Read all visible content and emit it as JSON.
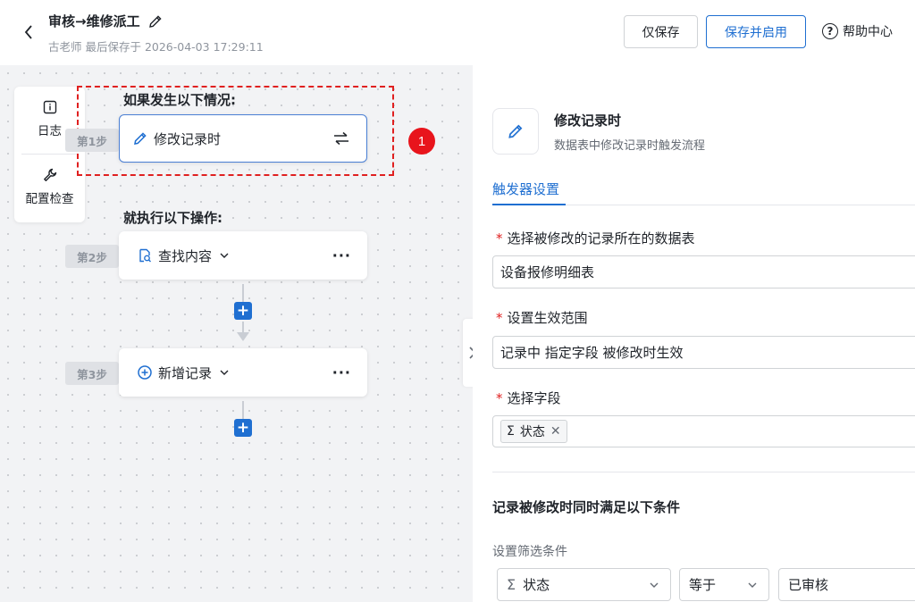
{
  "header": {
    "back_icon": "chevron-left-icon",
    "title": "审核→维修派工",
    "edit_icon": "pencil-icon",
    "subtitle": "古老师 最后保存于 2026-04-03 17:29:11",
    "save_only_label": "仅保存",
    "save_enable_label": "保存并启用",
    "help_label": "帮助中心",
    "accent_color": "#1f6fd1"
  },
  "side_tools": [
    {
      "icon": "info-icon",
      "label": "日志"
    },
    {
      "icon": "wrench-icon",
      "label": "配置检查"
    }
  ],
  "canvas": {
    "trigger_heading": "如果发生以下情况:",
    "action_heading": "就执行以下操作:",
    "steps": [
      {
        "tag": "第1步",
        "label": "修改记录时",
        "icon": "pencil-icon"
      },
      {
        "tag": "第2步",
        "label": "查找内容",
        "icon": "search-doc-icon"
      },
      {
        "tag": "第3步",
        "label": "新增记录",
        "icon": "plus-circle-icon"
      }
    ],
    "marker_number": "1",
    "add_label": "+",
    "more_label": "···"
  },
  "panel": {
    "title": "修改记录时",
    "description": "数据表中修改记录时触发流程",
    "tab": "触发器设置",
    "fields": [
      {
        "label": "选择被修改的记录所在的数据表",
        "value": "设备报修明细表"
      },
      {
        "label": "设置生效范围",
        "value": "记录中 指定字段 被修改时生效"
      },
      {
        "label": "选择字段",
        "tag": "状态",
        "tag_icon": "Σ",
        "remove": "✕"
      }
    ],
    "required_mark": "*",
    "condition_title": "记录被修改时同时满足以下条件",
    "filter_label": "设置筛选条件",
    "filter": {
      "field": "状态",
      "field_icon": "Σ",
      "operator": "等于",
      "value": "已审核"
    }
  }
}
